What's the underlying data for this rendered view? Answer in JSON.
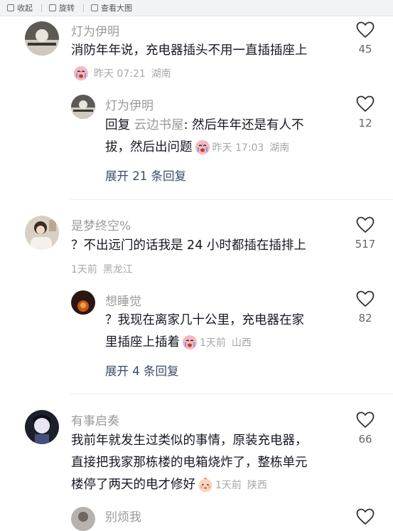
{
  "toolbar": {
    "collapse": "收起",
    "rotate": "旋转",
    "view_large": "查看大图"
  },
  "comments": [
    {
      "name": "灯为伊明",
      "text": "消防年年说，充电器插头不用一直插插座上",
      "time": "昨天 07:21",
      "location": "湖南",
      "likes": "45",
      "reply": {
        "name": "灯为伊明",
        "prefix": "回复 ",
        "reply_to": "云边书屋",
        "text_line1": ": 然后年年还是有人不",
        "text_line2": "拔，然后出问题",
        "time": "昨天 17:03",
        "location": "湖南",
        "likes": "12"
      },
      "expand": "展开 21 条回复"
    },
    {
      "name": "是梦终空%",
      "text": "？不出远门的话我是 24 小时都插在插排上",
      "time": "1天前",
      "location": "黑龙江",
      "likes": "517",
      "reply": {
        "name": "想睡觉",
        "text_line1": "？我现在离家几十公里，充电器在家",
        "text_line2": "里插座上插着",
        "time": "1天前",
        "location": "山西",
        "likes": "82"
      },
      "expand": "展开 4 条回复"
    },
    {
      "name": "有事启奏",
      "text_line1": "我前年就发生过类似的事情，原装充电器，",
      "text_line2": "直接把我家那栋楼的电箱烧炸了，整栋单元",
      "text_line3": "楼停了两天的电才修好",
      "time": "1天前",
      "location": "陕西",
      "likes": "66"
    },
    {
      "name": "别烦我"
    }
  ],
  "icons": {
    "like": "heart-outline-icon",
    "emoji_cry": "crying-face-emoji",
    "emoji_baby": "baby-face-emoji"
  },
  "colors": {
    "link": "#3a4a6b",
    "meta": "#a7a7a7",
    "name": "#9a9a9a"
  }
}
